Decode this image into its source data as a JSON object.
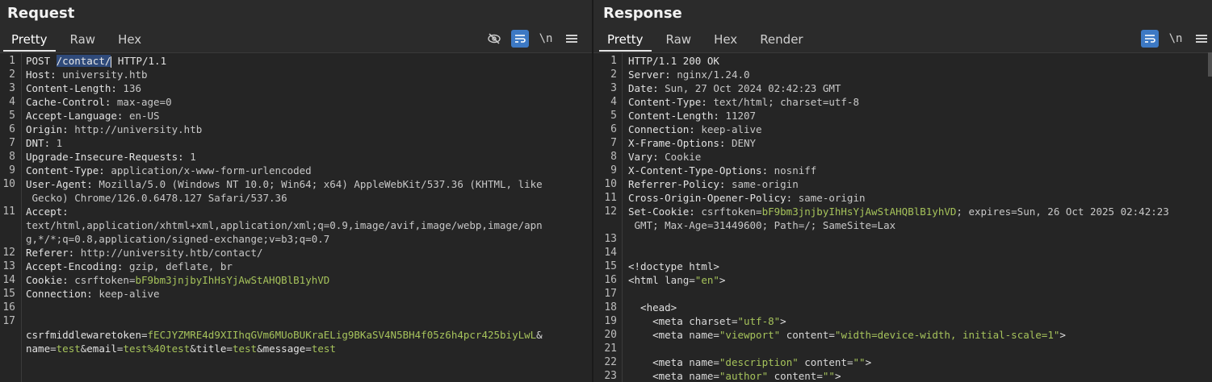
{
  "request": {
    "title": "Request",
    "tabs": [
      "Pretty",
      "Raw",
      "Hex"
    ],
    "tools": {
      "hide_icon": "eye-slash",
      "wrap_icon": "wrap",
      "newline_label": "\\n",
      "menu_icon": "hamburger"
    },
    "lines": [
      {
        "n": "1",
        "method": "POST ",
        "path": "/contact/",
        "rest": " HTTP/1.1"
      },
      {
        "n": "2",
        "k": "Host: ",
        "v": "university.htb"
      },
      {
        "n": "3",
        "k": "Content-Length: ",
        "v": "136"
      },
      {
        "n": "4",
        "k": "Cache-Control: ",
        "v": "max-age=0"
      },
      {
        "n": "5",
        "k": "Accept-Language: ",
        "v": "en-US"
      },
      {
        "n": "6",
        "k": "Origin: ",
        "v": "http://university.htb"
      },
      {
        "n": "7",
        "k": "DNT: ",
        "v": "1"
      },
      {
        "n": "8",
        "k": "Upgrade-Insecure-Requests: ",
        "v": "1"
      },
      {
        "n": "9",
        "k": "Content-Type: ",
        "v": "application/x-www-form-urlencoded"
      },
      {
        "n": "10",
        "k": "User-Agent: ",
        "v": "Mozilla/5.0 (Windows NT 10.0; Win64; x64) AppleWebKit/537.36 (KHTML, like",
        "v2": " Gecko) Chrome/126.0.6478.127 Safari/537.36"
      },
      {
        "n": "11",
        "k": "Accept: ",
        "v": "text/html,application/xhtml+xml,application/xml;q=0.9,image/avif,image/webp,image/apn",
        "v2": "g,*/*;q=0.8,application/signed-exchange;v=b3;q=0.7"
      },
      {
        "n": "12",
        "k": "Referer: ",
        "v": "http://university.htb/contact/"
      },
      {
        "n": "13",
        "k": "Accept-Encoding: ",
        "v": "gzip, deflate, br"
      },
      {
        "n": "14",
        "k": "Cookie: ",
        "ck": "csrftoken",
        "eq": "=",
        "cv": "bF9bm3jnjbyIhHsYjAwStAHQBlB1yhVD"
      },
      {
        "n": "15",
        "k": "Connection: ",
        "v": "keep-alive"
      },
      {
        "n": "16"
      },
      {
        "n": "17",
        "b1": "csrfmiddlewaretoken",
        "b1v": "fECJYZMRE4d9XIIhqGVm6MUoBUKraELig9BKaSV4N5BH4f05z6h4pcr425biyLwL",
        "b2": "name",
        "b2v": "test",
        "b3": "email",
        "b3v": "test%40test",
        "b4": "title",
        "b4v": "test",
        "b5": "message",
        "b5v": "test"
      }
    ]
  },
  "response": {
    "title": "Response",
    "tabs": [
      "Pretty",
      "Raw",
      "Hex",
      "Render"
    ],
    "tools": {
      "wrap_icon": "wrap",
      "newline_label": "\\n",
      "menu_icon": "hamburger"
    },
    "lines": [
      {
        "n": "1",
        "raw": "HTTP/1.1 200 OK"
      },
      {
        "n": "2",
        "k": "Server: ",
        "v": "nginx/1.24.0"
      },
      {
        "n": "3",
        "k": "Date: ",
        "v": "Sun, 27 Oct 2024 02:42:23 GMT"
      },
      {
        "n": "4",
        "k": "Content-Type: ",
        "v": "text/html; charset=utf-8"
      },
      {
        "n": "5",
        "k": "Content-Length: ",
        "v": "11207"
      },
      {
        "n": "6",
        "k": "Connection: ",
        "v": "keep-alive"
      },
      {
        "n": "7",
        "k": "X-Frame-Options: ",
        "v": "DENY"
      },
      {
        "n": "8",
        "k": "Vary: ",
        "v": "Cookie"
      },
      {
        "n": "9",
        "k": "X-Content-Type-Options: ",
        "v": "nosniff"
      },
      {
        "n": "10",
        "k": "Referrer-Policy: ",
        "v": "same-origin"
      },
      {
        "n": "11",
        "k": "Cross-Origin-Opener-Policy: ",
        "v": "same-origin"
      },
      {
        "n": "12",
        "k": "Set-Cookie: ",
        "ck": "csrftoken",
        "eq": "=",
        "cv": "bF9bm3jnjbyIhHsYjAwStAHQBlB1yhVD",
        "v": "; expires=Sun, 26 Oct 2025 02:42:23",
        "v2": " GMT; Max-Age=31449600; Path=/; SameSite=Lax"
      },
      {
        "n": "13"
      },
      {
        "n": "14"
      },
      {
        "n": "15",
        "raw": "<!doctype html>"
      },
      {
        "n": "16",
        "tag": "<html ",
        "a1": "lang",
        "a1v": "\"en\"",
        "close": ">"
      },
      {
        "n": "17"
      },
      {
        "n": "18",
        "raw": "  <head>"
      },
      {
        "n": "19",
        "ind": "    ",
        "tag": "<meta ",
        "a1": "charset",
        "a1v": "\"utf-8\"",
        "close": ">"
      },
      {
        "n": "20",
        "ind": "    ",
        "tag": "<meta ",
        "a1": "name",
        "a1v": "\"viewport\"",
        "a2": "content",
        "a2v": "\"width=device-width, initial-scale=1\"",
        "close": ">"
      },
      {
        "n": "21"
      },
      {
        "n": "22",
        "ind": "    ",
        "tag": "<meta ",
        "a1": "name",
        "a1v": "\"description\"",
        "a2": "content",
        "a2v": "\"\"",
        "close": ">"
      },
      {
        "n": "23",
        "ind": "    ",
        "tag": "<meta ",
        "a1": "name",
        "a1v": "\"author\"",
        "a2": "content",
        "a2v": "\"\"",
        "close": ">"
      }
    ]
  }
}
